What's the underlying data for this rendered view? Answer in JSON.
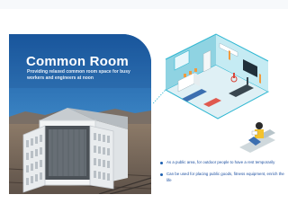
{
  "hero": {
    "title": "Common Room",
    "subtitle": "Providing relaxed common room space for busy workers and engineers at noon"
  },
  "features": [
    "As a public area, for outdoor people to have a rest temporarily",
    "Can be used for placing public goods, fitness equipment, enrich the life"
  ],
  "colors": {
    "brand_blue": "#1d60a8",
    "accent_cyan": "#2fb7d2",
    "text_blue": "#1c4fa0",
    "white": "#ffffff"
  },
  "icons": [
    "bullet-dot-icon",
    "person-reading-icon"
  ]
}
